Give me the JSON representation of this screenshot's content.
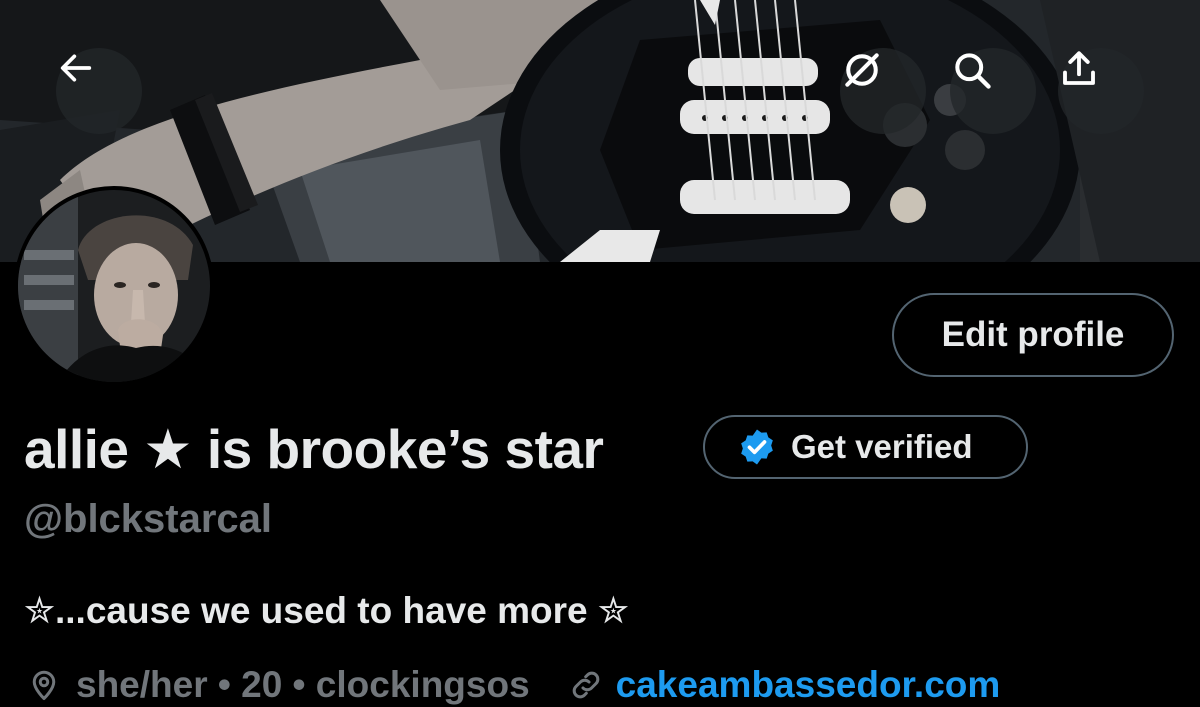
{
  "header": {
    "back_icon": "arrow-left-icon",
    "grok_icon": "grok-slash-circle-icon",
    "search_icon": "search-icon",
    "share_icon": "share-upload-icon"
  },
  "profile": {
    "display_name": "allie ★ is brooke’s star",
    "handle": "@blckstarcal",
    "edit_profile_label": "Edit profile",
    "get_verified_label": "Get verified",
    "bio": "✮...cause we used to have more ✮",
    "location": "she/her • 20 • clockingsos",
    "website": "cakeambassedor.com"
  },
  "colors": {
    "background": "#000000",
    "primary_text": "#e7e9ea",
    "secondary_text": "#71767b",
    "link": "#1d9bf0",
    "verified_badge": "#1d9bf0",
    "border": "#536471"
  }
}
